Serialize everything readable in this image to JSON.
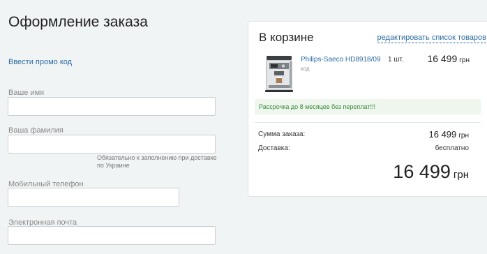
{
  "page": {
    "title": "Оформление заказа",
    "promo_link": "Ввести промо код"
  },
  "form": {
    "first_name_label": "Ваше имя",
    "first_name_value": "",
    "last_name_label": "Ваша фамилия",
    "last_name_value": "",
    "last_name_hint": "Обязательно к заполнению при доставке по Украине",
    "phone_label": "Мобильный телефон",
    "phone_value": "",
    "email_label": "Электронная почта",
    "email_value": ""
  },
  "cart": {
    "title": "В корзине",
    "edit_link": "редактировать список товаров",
    "item": {
      "name": "Philips-Saeco HD8918/09",
      "code_label": "код",
      "quantity": "1 шт.",
      "price": "16 499",
      "currency": "грн",
      "image_icon": "coffee-machine-icon"
    },
    "installment_text": "Рассрочка до 8 месяцев без переплат!!!",
    "order_sum_label": "Сумма заказа:",
    "order_sum_value": "16 499",
    "order_sum_currency": "грн",
    "delivery_label": "Доставка:",
    "delivery_value": "бесплатно",
    "total_value": "16 499",
    "total_currency": "грн"
  },
  "colors": {
    "background": "#f1f4f5",
    "link": "#2b6aa3",
    "installment_bg": "#eef6ee",
    "installment_text": "#3a8a3a"
  }
}
